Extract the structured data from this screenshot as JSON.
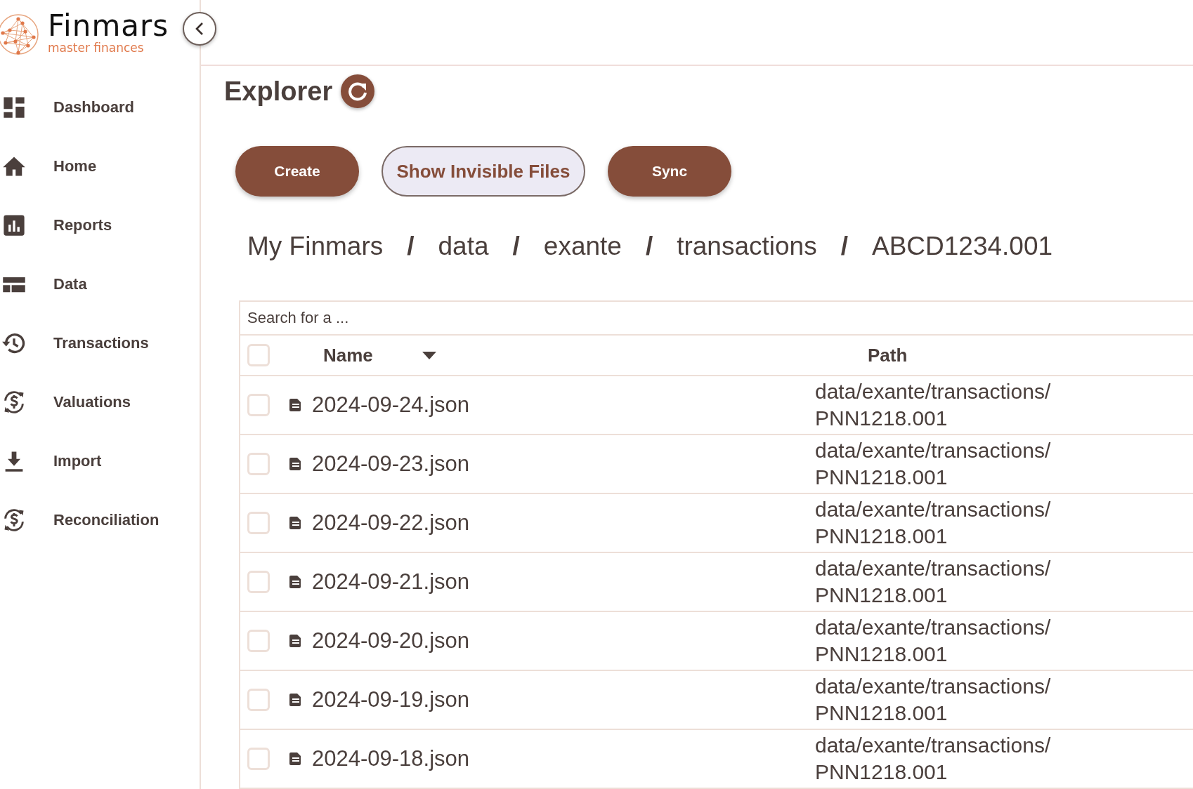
{
  "logo": {
    "name": "Finmars",
    "tagline": "master finances"
  },
  "sidebar": {
    "items": [
      {
        "label": "Dashboard"
      },
      {
        "label": "Home"
      },
      {
        "label": "Reports"
      },
      {
        "label": "Data"
      },
      {
        "label": "Transactions"
      },
      {
        "label": "Valuations"
      },
      {
        "label": "Import"
      },
      {
        "label": "Reconciliation"
      }
    ]
  },
  "page": {
    "title": "Explorer"
  },
  "buttons": [
    {
      "label": "Create",
      "kind": "filled"
    },
    {
      "label": "Show Invisible Files",
      "kind": "outlined"
    },
    {
      "label": "Sync",
      "kind": "filled"
    }
  ],
  "breadcrumb": {
    "separator": "/",
    "items": [
      "My Finmars",
      "data",
      "exante",
      "transactions",
      "ABCD1234.001"
    ]
  },
  "table": {
    "search": {
      "placeholder": "Search for a ..."
    },
    "header_checked": false,
    "columns": [
      {
        "label": "Name",
        "sorted": true
      },
      {
        "label": "Path"
      }
    ],
    "rows": [
      {
        "name": "2024-09-24.json",
        "path": "data/exante/transactions/PNN1218.001",
        "checked": false
      },
      {
        "name": "2024-09-23.json",
        "path": "data/exante/transactions/PNN1218.001",
        "checked": false
      },
      {
        "name": "2024-09-22.json",
        "path": "data/exante/transactions/PNN1218.001",
        "checked": false
      },
      {
        "name": "2024-09-21.json",
        "path": "data/exante/transactions/PNN1218.001",
        "checked": false
      },
      {
        "name": "2024-09-20.json",
        "path": "data/exante/transactions/PNN1218.001",
        "checked": false
      },
      {
        "name": "2024-09-19.json",
        "path": "data/exante/transactions/PNN1218.001",
        "checked": false
      },
      {
        "name": "2024-09-18.json",
        "path": "data/exante/transactions/PNN1218.001",
        "checked": false
      }
    ]
  }
}
